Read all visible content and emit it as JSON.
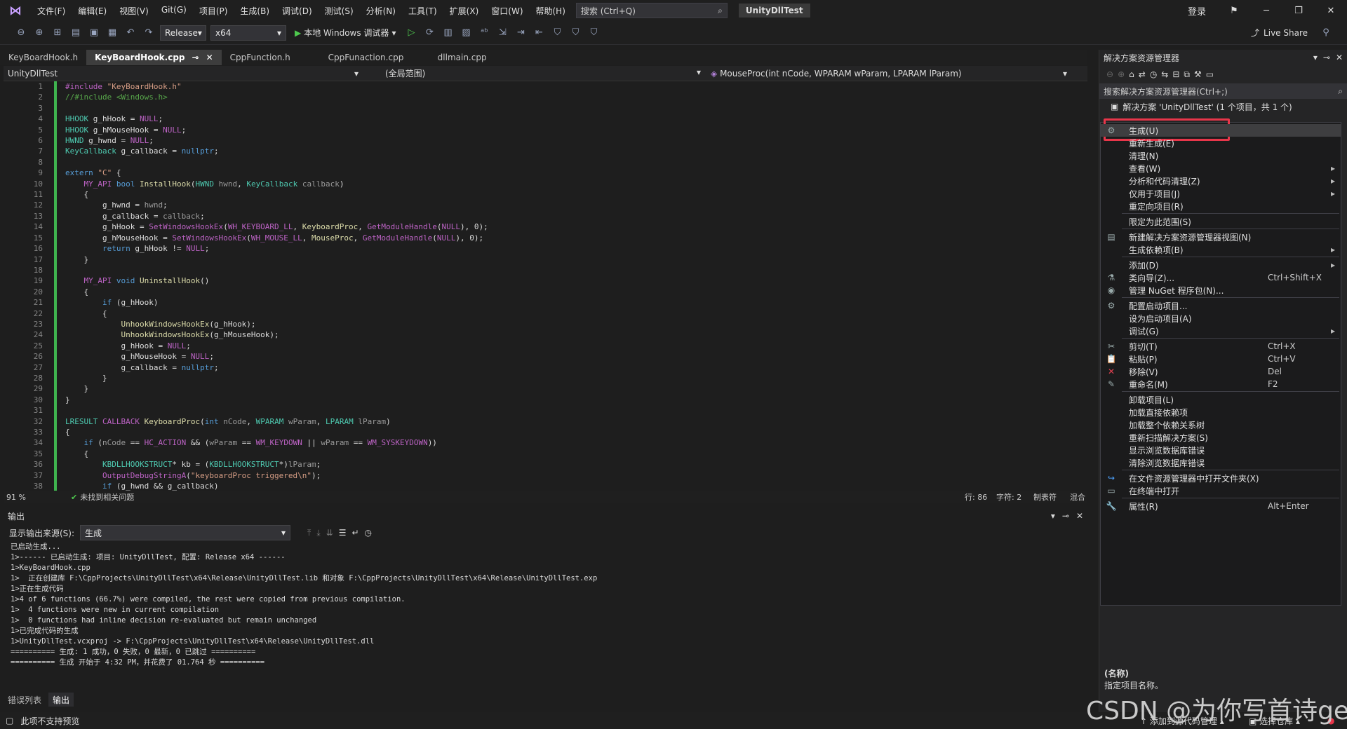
{
  "menubar": {
    "items": [
      "文件(F)",
      "编辑(E)",
      "视图(V)",
      "Git(G)",
      "项目(P)",
      "生成(B)",
      "调试(D)",
      "测试(S)",
      "分析(N)",
      "工具(T)",
      "扩展(X)",
      "窗口(W)",
      "帮助(H)"
    ],
    "search_placeholder": "搜索 (Ctrl+Q)",
    "solution_name": "UnityDllTest",
    "login": "登录"
  },
  "toolbar": {
    "config": "Release",
    "platform": "x64",
    "run_label": "本地 Windows 调试器",
    "live_share": "Live Share"
  },
  "tabs": [
    {
      "label": "KeyBoardHook.h"
    },
    {
      "label": "KeyBoardHook.cpp"
    },
    {
      "label": "CppFunction.h"
    },
    {
      "label": "CppFunaction.cpp"
    },
    {
      "label": "dllmain.cpp"
    }
  ],
  "navbar": {
    "project": "UnityDllTest",
    "scope": "(全局范围)",
    "member": "MouseProc(int nCode, WPARAM wParam, LPARAM lParam)"
  },
  "editor": {
    "line_numbers": [
      "1",
      "2",
      "3",
      "4",
      "5",
      "6",
      "7",
      "8",
      "9",
      "10",
      "11",
      "12",
      "13",
      "14",
      "15",
      "16",
      "17",
      "18",
      "19",
      "20",
      "21",
      "22",
      "23",
      "24",
      "25",
      "26",
      "27",
      "28",
      "29",
      "30",
      "31",
      "32",
      "33",
      "34",
      "35",
      "36",
      "37",
      "38"
    ]
  },
  "status1": {
    "zoom": "91 %",
    "issues": "未找到相关问题",
    "line": "行: 86",
    "col": "字符: 2",
    "tabs": "制表符",
    "eol": "混合"
  },
  "output": {
    "title": "输出",
    "source_label": "显示输出来源(S):",
    "source_value": "生成",
    "lines": [
      "已启动生成...",
      "1>------ 已启动生成: 项目: UnityDllTest, 配置: Release x64 ------",
      "1>KeyBoardHook.cpp",
      "1>  正在创建库 F:\\CppProjects\\UnityDllTest\\x64\\Release\\UnityDllTest.lib 和对象 F:\\CppProjects\\UnityDllTest\\x64\\Release\\UnityDllTest.exp",
      "1>正在生成代码",
      "1>4 of 6 functions (66.7%) were compiled, the rest were copied from previous compilation.",
      "1>  4 functions were new in current compilation",
      "1>  0 functions had inline decision re-evaluated but remain unchanged",
      "1>已完成代码的生成",
      "1>UnityDllTest.vcxproj -> F:\\CppProjects\\UnityDllTest\\x64\\Release\\UnityDllTest.dll",
      "========== 生成: 1 成功，0 失败，0 最新，0 已跳过 ==========",
      "========== 生成 开始于 4:32 PM，并花费了 01.764 秒 =========="
    ]
  },
  "bottom_tabs": [
    "错误列表",
    "输出"
  ],
  "statusbar": {
    "left": "此项不支持预览",
    "add_source": "添加到源代码管理",
    "select_repo": "选择仓库"
  },
  "solution_explorer": {
    "title": "解决方案资源管理器",
    "search": "搜索解决方案资源管理器(Ctrl+;)",
    "root": "解决方案 'UnityDllTest' (1 个项目，共 1 个)"
  },
  "context_menu": {
    "items": [
      {
        "label": "生成(U)",
        "icon": "build-icon",
        "shortcut": "",
        "arrow": false
      },
      {
        "label": "重新生成(E)",
        "icon": "",
        "shortcut": "",
        "arrow": false
      },
      {
        "label": "清理(N)",
        "icon": "",
        "shortcut": "",
        "arrow": false
      },
      {
        "label": "查看(W)",
        "icon": "",
        "shortcut": "",
        "arrow": true
      },
      {
        "label": "分析和代码清理(Z)",
        "icon": "",
        "shortcut": "",
        "arrow": true
      },
      {
        "label": "仅用于项目(J)",
        "icon": "",
        "shortcut": "",
        "arrow": true
      },
      {
        "label": "重定向项目(R)",
        "icon": "",
        "shortcut": "",
        "arrow": false
      },
      {
        "label": "限定为此范围(S)",
        "icon": "",
        "shortcut": "",
        "arrow": false
      },
      {
        "label": "新建解决方案资源管理器视图(N)",
        "icon": "new-view-icon",
        "shortcut": "",
        "arrow": false
      },
      {
        "label": "生成依赖项(B)",
        "icon": "",
        "shortcut": "",
        "arrow": true
      },
      {
        "label": "添加(D)",
        "icon": "",
        "shortcut": "",
        "arrow": true
      },
      {
        "label": "类向导(Z)...",
        "icon": "class-wizard-icon",
        "shortcut": "Ctrl+Shift+X",
        "arrow": false
      },
      {
        "label": "管理 NuGet 程序包(N)...",
        "icon": "nuget-icon",
        "shortcut": "",
        "arrow": false
      },
      {
        "label": "配置启动项目...",
        "icon": "gear-icon",
        "shortcut": "",
        "arrow": false
      },
      {
        "label": "设为启动项目(A)",
        "icon": "",
        "shortcut": "",
        "arrow": false
      },
      {
        "label": "调试(G)",
        "icon": "",
        "shortcut": "",
        "arrow": true
      },
      {
        "label": "剪切(T)",
        "icon": "cut-icon",
        "shortcut": "Ctrl+X",
        "arrow": false
      },
      {
        "label": "粘贴(P)",
        "icon": "paste-icon",
        "shortcut": "Ctrl+V",
        "arrow": false
      },
      {
        "label": "移除(V)",
        "icon": "remove-icon",
        "shortcut": "Del",
        "arrow": false
      },
      {
        "label": "重命名(M)",
        "icon": "rename-icon",
        "shortcut": "F2",
        "arrow": false
      },
      {
        "label": "卸载项目(L)",
        "icon": "",
        "shortcut": "",
        "arrow": false
      },
      {
        "label": "加载直接依赖项",
        "icon": "",
        "shortcut": "",
        "arrow": false
      },
      {
        "label": "加载整个依赖关系树",
        "icon": "",
        "shortcut": "",
        "arrow": false
      },
      {
        "label": "重新扫描解决方案(S)",
        "icon": "",
        "shortcut": "",
        "arrow": false
      },
      {
        "label": "显示浏览数据库错误",
        "icon": "",
        "shortcut": "",
        "arrow": false
      },
      {
        "label": "清除浏览数据库错误",
        "icon": "",
        "shortcut": "",
        "arrow": false
      },
      {
        "label": "在文件资源管理器中打开文件夹(X)",
        "icon": "open-folder-icon",
        "shortcut": "",
        "arrow": false
      },
      {
        "label": "在终端中打开",
        "icon": "terminal-icon",
        "shortcut": "",
        "arrow": false
      },
      {
        "label": "属性(R)",
        "icon": "wrench-icon",
        "shortcut": "Alt+Enter",
        "arrow": false
      }
    ]
  },
  "properties": {
    "name": "(名称)",
    "desc": "指定项目名称。"
  },
  "watermark": "CSDN @为你写首诗ge",
  "colors": {
    "highlight_box": "#e8364a",
    "green_change_bar": "#3fb34f"
  }
}
